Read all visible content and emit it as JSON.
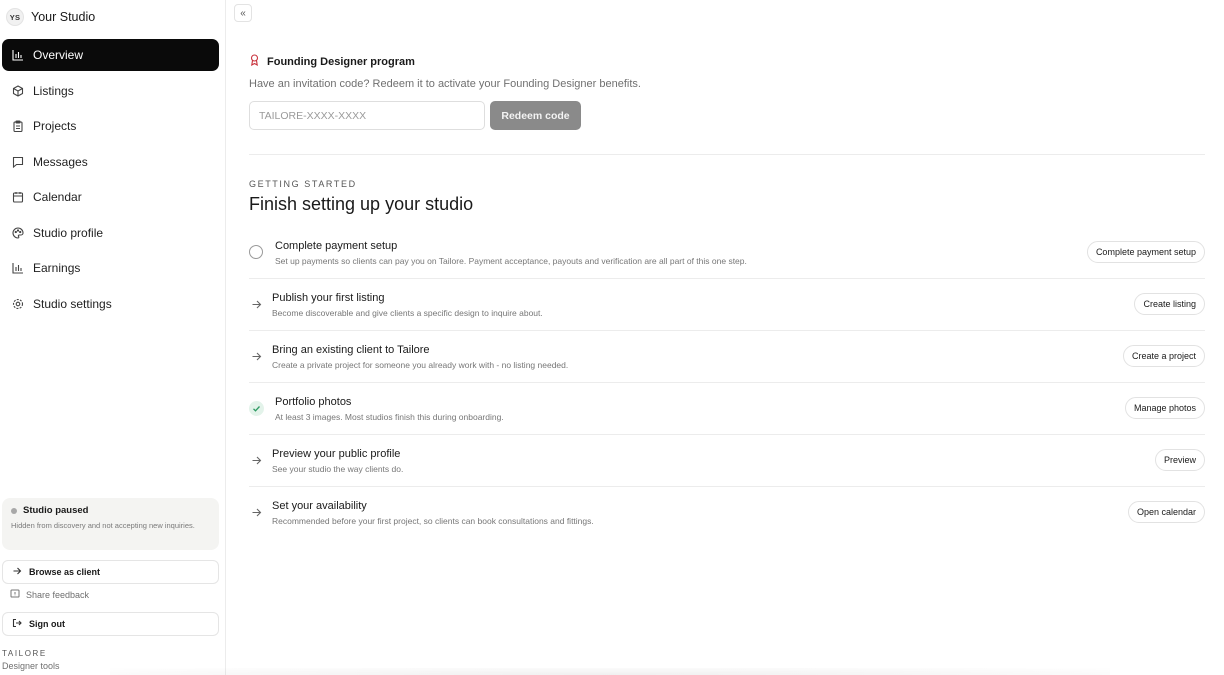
{
  "sidebar": {
    "avatar_initials": "YS",
    "studio_name": "Your Studio",
    "nav": [
      {
        "label": "Overview",
        "icon": "bar-chart-icon",
        "active": true
      },
      {
        "label": "Listings",
        "icon": "package-icon"
      },
      {
        "label": "Projects",
        "icon": "clipboard-icon"
      },
      {
        "label": "Messages",
        "icon": "message-icon"
      },
      {
        "label": "Calendar",
        "icon": "calendar-icon"
      },
      {
        "label": "Studio profile",
        "icon": "palette-icon"
      },
      {
        "label": "Earnings",
        "icon": "bar-chart-icon"
      },
      {
        "label": "Studio settings",
        "icon": "gear-icon"
      }
    ],
    "status": {
      "title": "Studio paused",
      "description": "Hidden from discovery and not accepting new inquiries."
    },
    "browse_label": "Browse as client",
    "feedback_label": "Share feedback",
    "signout_label": "Sign out",
    "brand_name": "TAILORE",
    "brand_sub": "Designer tools"
  },
  "founding": {
    "title": "Founding Designer program",
    "description": "Have an invitation code? Redeem it to activate your Founding Designer benefits.",
    "code_placeholder": "TAILORE-XXXX-XXXX",
    "redeem_label": "Redeem code"
  },
  "getting_started": {
    "label": "GETTING STARTED",
    "title": "Finish setting up your studio",
    "tasks": [
      {
        "status": "incomplete",
        "title": "Complete payment setup",
        "description": "Set up payments so clients can pay you on Tailore. Payment acceptance, payouts and verification are all part of this one step.",
        "action": "Complete payment setup"
      },
      {
        "status": "pending",
        "title": "Publish your first listing",
        "description": "Become discoverable and give clients a specific design to inquire about.",
        "action": "Create listing"
      },
      {
        "status": "pending",
        "title": "Bring an existing client to Tailore",
        "description": "Create a private project for someone you already work with - no listing needed.",
        "action": "Create a project"
      },
      {
        "status": "done",
        "title": "Portfolio photos",
        "description": "At least 3 images. Most studios finish this during onboarding.",
        "action": "Manage photos"
      },
      {
        "status": "pending",
        "title": "Preview your public profile",
        "description": "See your studio the way clients do.",
        "action": "Preview"
      },
      {
        "status": "pending",
        "title": "Set your availability",
        "description": "Recommended before your first project, so clients can book consultations and fittings.",
        "action": "Open calendar"
      }
    ]
  },
  "colors": {
    "active_nav_bg": "#0a0a0a",
    "redeem_bg": "#8a8a8a",
    "done_check": "#2e9a63"
  }
}
